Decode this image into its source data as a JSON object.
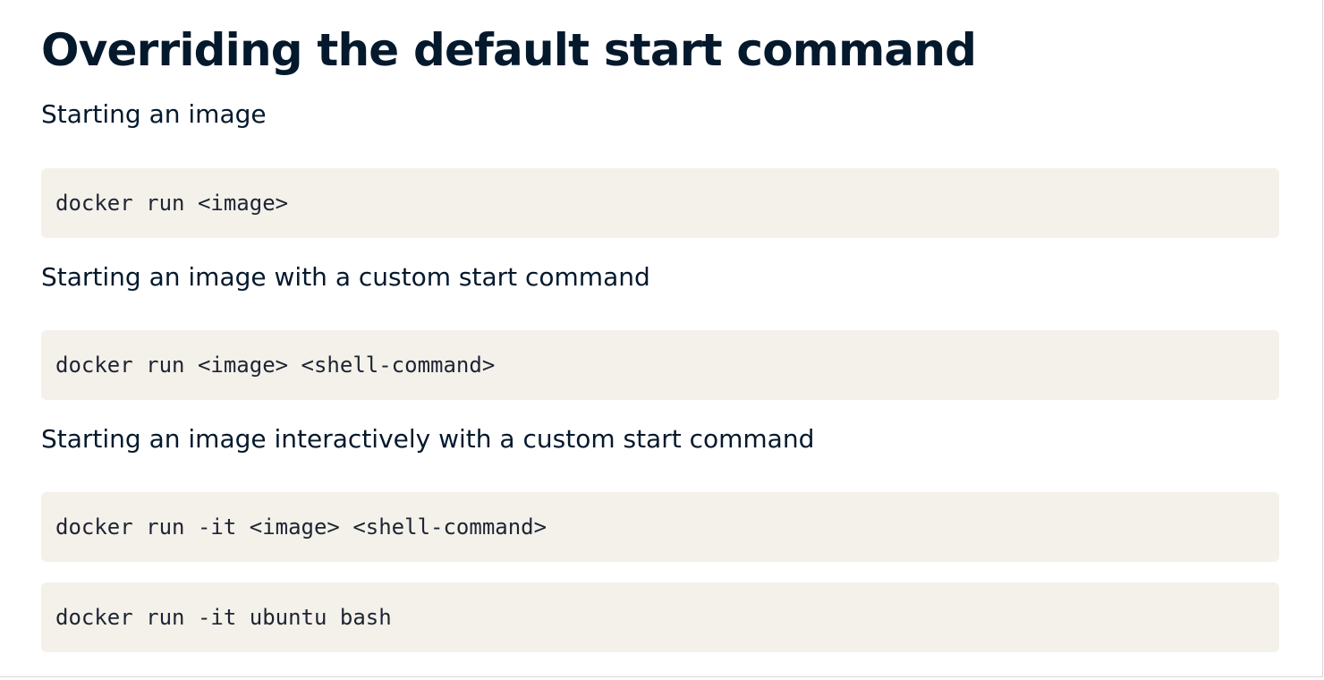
{
  "section": {
    "title": "Overriding the default start command",
    "items": [
      {
        "label": "Starting an image",
        "code": "docker run <image>"
      },
      {
        "label": "Starting an image with a custom start command",
        "code": "docker run <image> <shell-command>"
      },
      {
        "label": "Starting an image interactively with a custom start command",
        "code": "docker run -it <image> <shell-command>"
      }
    ],
    "example_code": "docker run -it ubuntu bash"
  },
  "colors": {
    "text": "#05192d",
    "code_background": "#f4f1ea",
    "code_text": "#1d2433"
  }
}
